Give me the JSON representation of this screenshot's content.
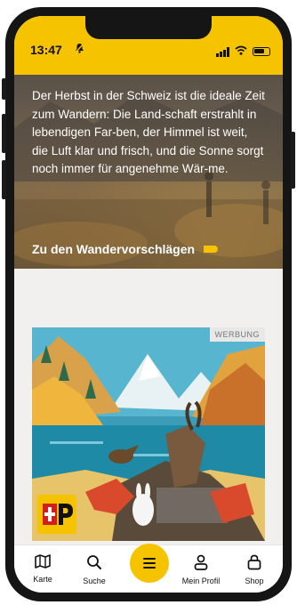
{
  "status": {
    "time": "13:47"
  },
  "hero": {
    "text": "Der Herbst in der Schweiz ist die ideale Zeit zum Wandern: Die Land-schaft erstrahlt in lebendigen Far-ben, der Himmel ist weit, die Luft klar und frisch, und die Sonne sorgt noch immer für angenehme Wär-me.",
    "link_label": "Zu den Wandervorschlägen"
  },
  "ad": {
    "label": "WERBUNG"
  },
  "tabbar": {
    "items": [
      {
        "label": "Karte",
        "icon": "map-icon"
      },
      {
        "label": "Suche",
        "icon": "search-icon"
      },
      {
        "label": "",
        "icon": "menu-icon"
      },
      {
        "label": "Mein Profil",
        "icon": "person-icon"
      },
      {
        "label": "Shop",
        "icon": "shopping-bag-icon"
      }
    ]
  },
  "colors": {
    "accent": "#f6c300",
    "background": "#f2f0ef"
  }
}
